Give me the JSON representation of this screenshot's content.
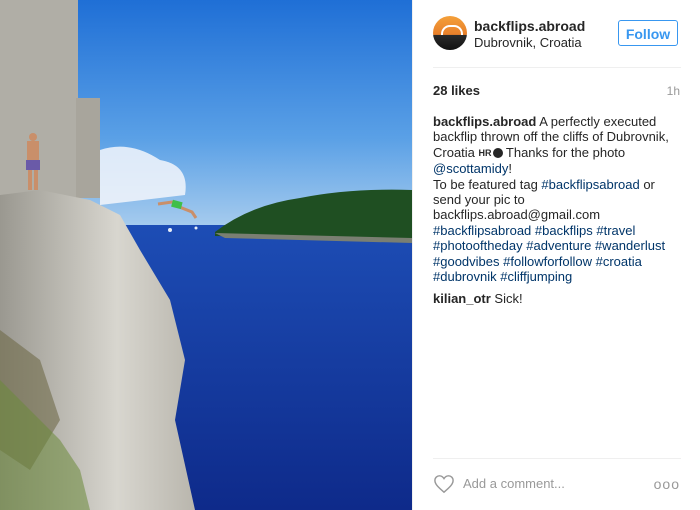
{
  "post": {
    "username": "backflips.abroad",
    "location": "Dubrovnik, Croatia",
    "follow_label": "Follow",
    "likes": "28 likes",
    "time": "1h",
    "caption": {
      "author": "backflips.abroad",
      "line1": " A perfectly executed backflip thrown off the cliffs of Dubrovnik, Croatia ",
      "flag_text": "HR",
      "line2": " Thanks for the photo ",
      "mention": "@scottamidy",
      "line3": "!",
      "line4": "To be featured tag ",
      "hashtag_feature": "#backflipsabroad",
      "line5": " or send your pic to backflips.abroad@gmail.com",
      "hashtags": [
        "#backflipsabroad",
        "#backflips",
        "#travel",
        "#photooftheday",
        "#adventure",
        "#wanderlust",
        "#goodvibes",
        "#followforfollow",
        "#croatia",
        "#dubrovnik",
        "#cliffjumping"
      ]
    },
    "comments": [
      {
        "user": "kilian_otr",
        "text": "Sick!"
      }
    ],
    "add_comment_placeholder": "Add a comment...",
    "more_icon": "ooo"
  },
  "icons": {
    "heart": "heart-icon",
    "more": "more-options-icon"
  },
  "colors": {
    "accent": "#3897f0",
    "hashtag": "#003569",
    "muted": "#999999"
  }
}
